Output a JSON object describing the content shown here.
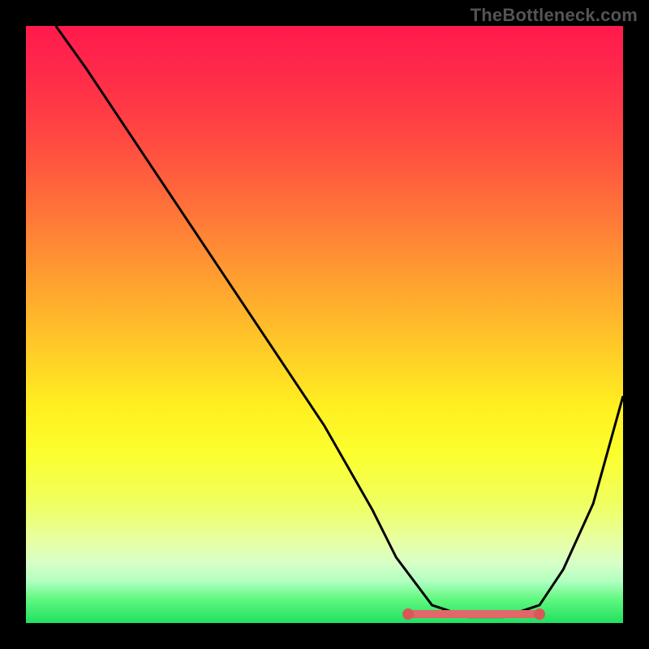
{
  "watermark": "TheBottleneck.com",
  "chart_data": {
    "type": "line",
    "title": "",
    "xlabel": "",
    "ylabel": "",
    "xlim": [
      0,
      100
    ],
    "ylim": [
      0,
      100
    ],
    "series": [
      {
        "name": "curve",
        "color": "#000000",
        "x": [
          5,
          10,
          20,
          30,
          40,
          50,
          58,
          62,
          68,
          74,
          80,
          86,
          90,
          95,
          100
        ],
        "values": [
          100,
          93,
          78,
          63,
          48,
          33,
          19,
          11,
          3,
          1,
          1,
          3,
          9,
          20,
          38
        ]
      }
    ],
    "flat_region": {
      "x_start": 64,
      "x_end": 86,
      "y": 1.5,
      "color": "#e06868",
      "endpoint_color": "#d85858"
    },
    "gradient_stops": [
      {
        "pct": 0,
        "color": "#ff1a4d"
      },
      {
        "pct": 50,
        "color": "#ffc828"
      },
      {
        "pct": 75,
        "color": "#faff2a"
      },
      {
        "pct": 100,
        "color": "#20e060"
      }
    ]
  }
}
